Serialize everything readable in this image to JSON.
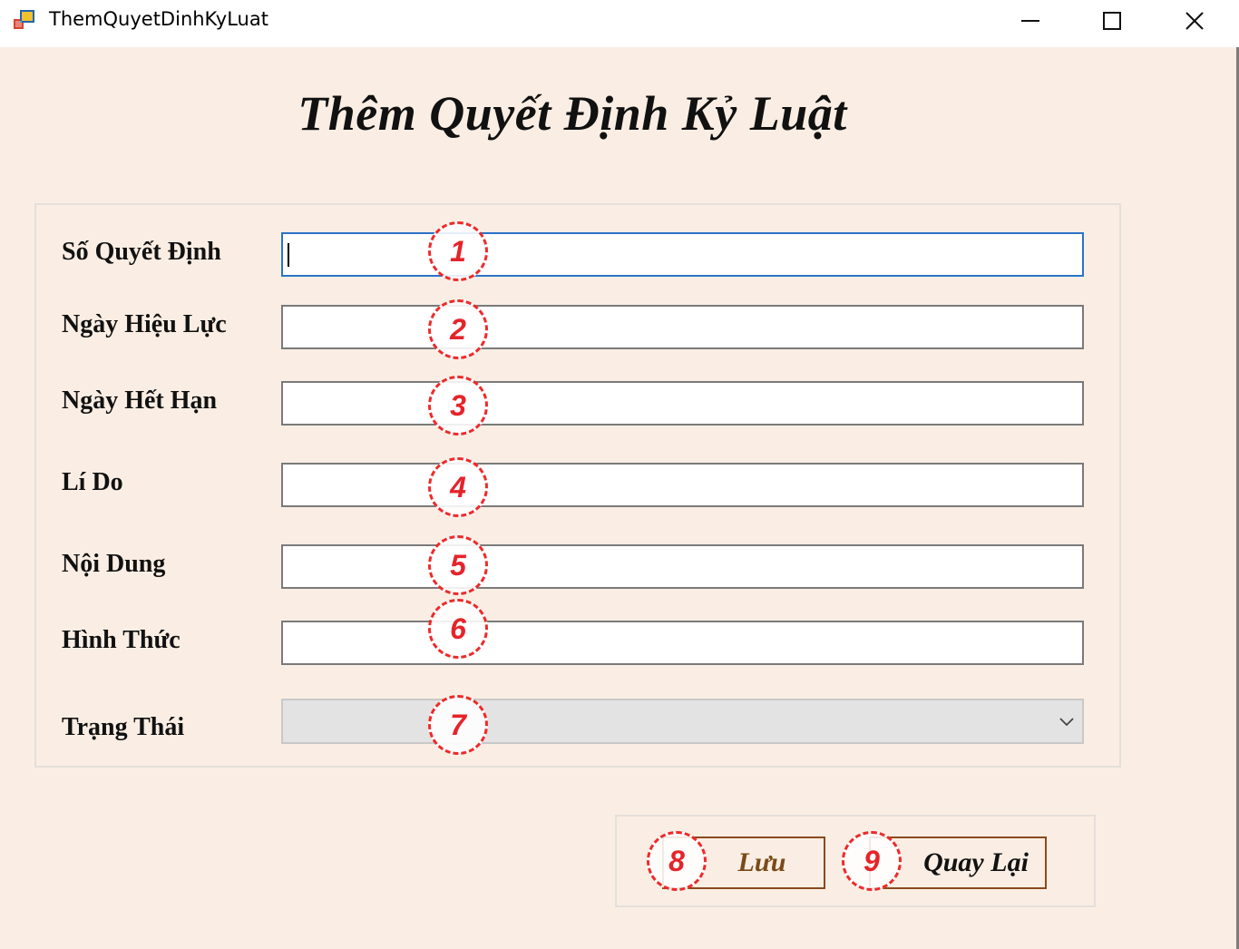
{
  "window": {
    "title": "ThemQuyetDinhKyLuat",
    "controls": {
      "minimize": "minimize-icon",
      "maximize": "maximize-icon",
      "close": "close-icon"
    }
  },
  "page": {
    "heading": "Thêm Quyết Định Kỷ Luật"
  },
  "form": {
    "fields": [
      {
        "label": "Số Quyết Định",
        "value": "",
        "badge": "1"
      },
      {
        "label": "Ngày Hiệu Lực",
        "value": "",
        "badge": "2"
      },
      {
        "label": "Ngày Hết Hạn",
        "value": "",
        "badge": "3"
      },
      {
        "label": "Lí Do",
        "value": "",
        "badge": "4"
      },
      {
        "label": "Nội Dung",
        "value": "",
        "badge": "5"
      },
      {
        "label": "Hình Thức",
        "value": "",
        "badge": "6"
      }
    ],
    "status": {
      "label": "Trạng Thái",
      "selected": "",
      "badge": "7"
    }
  },
  "actions": {
    "save": {
      "label": "Lưu",
      "badge": "8"
    },
    "back": {
      "label": "Quay Lại",
      "badge": "9"
    }
  },
  "colors": {
    "background": "#faeee4",
    "focus_border": "#2a73c8",
    "badge": "#e5242a",
    "button_border": "#8a4a1c"
  }
}
